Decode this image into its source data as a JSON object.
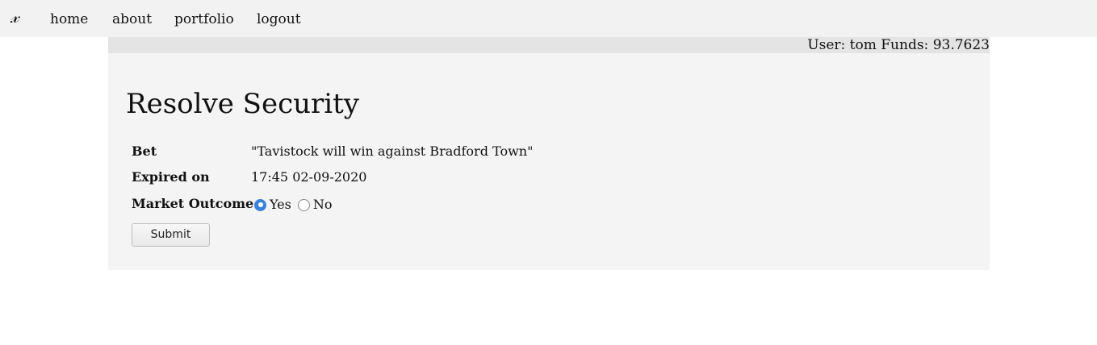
{
  "nav": {
    "brand": "𝓍",
    "items": [
      {
        "label": "home"
      },
      {
        "label": "about"
      },
      {
        "label": "portfolio"
      },
      {
        "label": "logout"
      }
    ]
  },
  "user_info": "User: tom Funds: 93.7623",
  "page_title": "Resolve Security",
  "form": {
    "bet_label": "Bet",
    "bet_value": "\"Tavistock will win against Bradford Town\"",
    "expired_label": "Expired on",
    "expired_value": "17:45 02-09-2020",
    "outcome_label": "Market Outcome",
    "options": [
      {
        "label": "Yes",
        "selected": true
      },
      {
        "label": "No",
        "selected": false
      }
    ],
    "submit_label": "Submit"
  },
  "colors": {
    "radio_accent": "#3b82dc",
    "navbar_bg": "#f2f2f2",
    "panel_bg": "#f4f4f4"
  }
}
